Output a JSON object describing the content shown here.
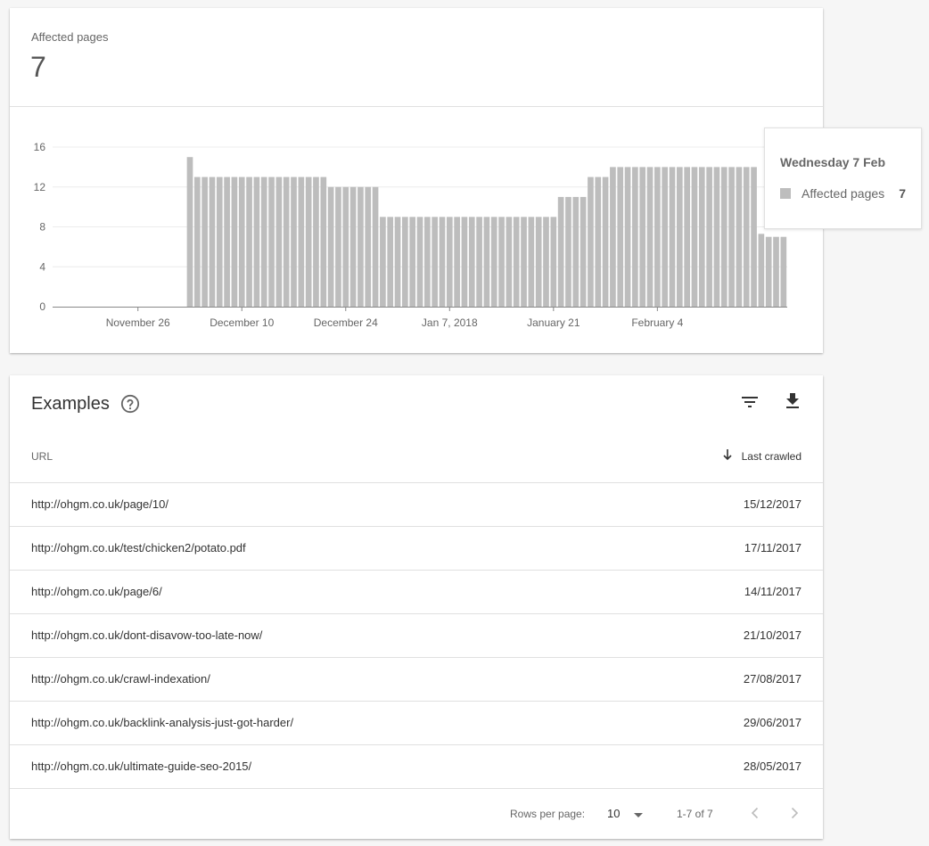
{
  "summary": {
    "label": "Affected pages",
    "value": "7"
  },
  "tooltip": {
    "title": "Wednesday 7 Feb",
    "label": "Affected pages",
    "value": "7"
  },
  "colors": {
    "bar": "#bdbdbd",
    "grid": "#ececec",
    "axis": "#888888"
  },
  "chart_data": {
    "type": "bar",
    "series": [
      {
        "name": "Affected pages",
        "values": [
          0,
          0,
          0,
          0,
          0,
          0,
          0,
          0,
          0,
          0,
          0,
          0,
          0,
          0,
          0,
          0,
          0,
          0,
          15,
          13,
          13,
          13,
          13,
          13,
          13,
          13,
          13,
          13,
          13,
          13,
          13,
          13,
          13,
          13,
          13,
          13,
          13,
          12,
          12,
          12,
          12,
          12,
          12,
          12,
          9,
          9,
          9,
          9,
          9,
          9,
          9,
          9,
          9,
          9,
          9,
          9,
          9,
          9,
          9,
          9,
          9,
          9,
          9,
          9,
          9,
          9,
          9,
          9,
          11,
          11,
          11,
          11,
          13,
          13,
          13,
          14,
          14,
          14,
          14,
          14,
          14,
          14,
          14,
          14,
          14,
          14,
          14,
          14,
          14,
          14,
          14,
          14,
          14,
          14,
          14,
          7.3,
          7,
          7,
          7
        ]
      }
    ],
    "xticks": [
      "November 26",
      "December 10",
      "December 24",
      "Jan 7, 2018",
      "January 21",
      "February 4"
    ],
    "yticks": [
      "0",
      "4",
      "8",
      "12",
      "16"
    ],
    "ylim": [
      0,
      16
    ]
  },
  "examples": {
    "title": "Examples",
    "icons": {
      "help": "help-circle-icon",
      "filter": "filter-icon",
      "download": "download-icon",
      "sort": "arrow-down-icon"
    },
    "columns": {
      "url": "URL",
      "last_crawled": "Last crawled"
    },
    "rows": [
      {
        "url": "http://ohgm.co.uk/page/10/",
        "date": "15/12/2017"
      },
      {
        "url": "http://ohgm.co.uk/test/chicken2/potato.pdf",
        "date": "17/11/2017"
      },
      {
        "url": "http://ohgm.co.uk/page/6/",
        "date": "14/11/2017"
      },
      {
        "url": "http://ohgm.co.uk/dont-disavow-too-late-now/",
        "date": "21/10/2017"
      },
      {
        "url": "http://ohgm.co.uk/crawl-indexation/",
        "date": "27/08/2017"
      },
      {
        "url": "http://ohgm.co.uk/backlink-analysis-just-got-harder/",
        "date": "29/06/2017"
      },
      {
        "url": "http://ohgm.co.uk/ultimate-guide-seo-2015/",
        "date": "28/05/2017"
      }
    ],
    "footer": {
      "rows_per_page_label": "Rows per page:",
      "rows_per_page_value": "10",
      "range": "1-7 of 7"
    }
  }
}
